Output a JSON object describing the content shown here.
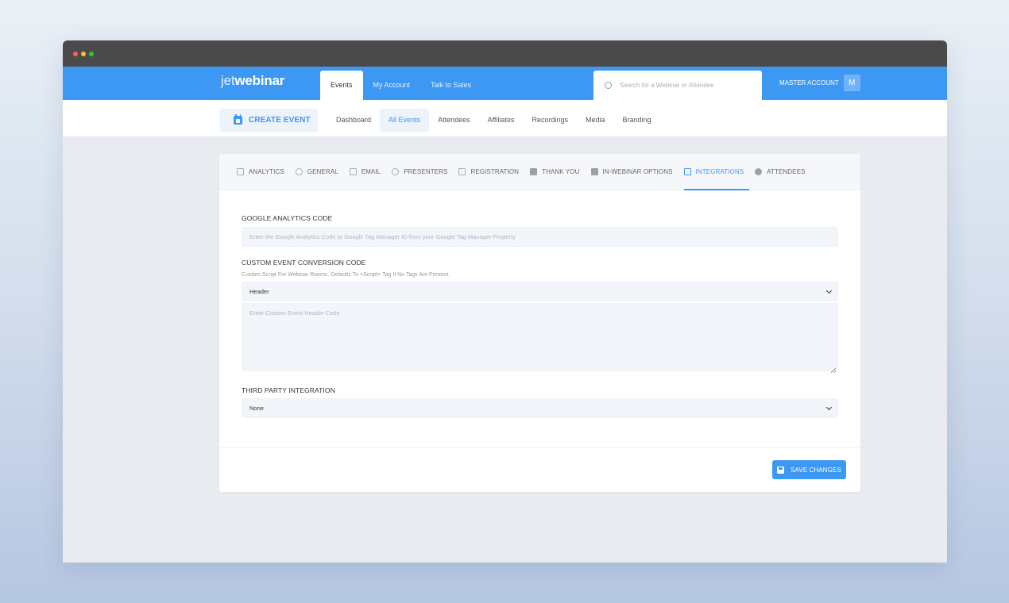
{
  "header": {
    "logo_light": "jet",
    "logo_bold": "webinar",
    "tabs": [
      {
        "label": "Events",
        "active": true
      },
      {
        "label": "My Account",
        "active": false
      },
      {
        "label": "Talk to Sales",
        "active": false
      }
    ],
    "search_placeholder": "Search for a Webinar or Attendee",
    "account_label": "MASTER ACCOUNT",
    "avatar_initial": "M"
  },
  "subnav": {
    "create_label": "CREATE EVENT",
    "items": [
      {
        "label": "Dashboard",
        "active": false
      },
      {
        "label": "All Events",
        "active": true
      },
      {
        "label": "Attendees",
        "active": false
      },
      {
        "label": "Affiliates",
        "active": false
      },
      {
        "label": "Recordings",
        "active": false
      },
      {
        "label": "Media",
        "active": false
      },
      {
        "label": "Branding",
        "active": false
      }
    ]
  },
  "event_tabs": [
    {
      "label": "ANALYTICS",
      "icon": "chart-icon"
    },
    {
      "label": "GENERAL",
      "icon": "gear-icon"
    },
    {
      "label": "EMAIL",
      "icon": "envelope-icon"
    },
    {
      "label": "PRESENTERS",
      "icon": "user-circle-icon"
    },
    {
      "label": "REGISTRATION",
      "icon": "form-icon"
    },
    {
      "label": "THANK YOU",
      "icon": "layers-icon"
    },
    {
      "label": "IN-WEBINAR OPTIONS",
      "icon": "grid-icon"
    },
    {
      "label": "INTEGRATIONS",
      "icon": "plug-icon",
      "active": true
    },
    {
      "label": "ATTENDEES",
      "icon": "user-icon"
    }
  ],
  "form": {
    "ga_label": "GOOGLE ANALYTICS CODE",
    "ga_placeholder": "Enter the Google Analytics Code or Google Tag Manager ID from your Google Tag Manager Property",
    "custom_label": "CUSTOM EVENT CONVERSION CODE",
    "custom_hint": "Custom Script For Webinar Rooms. Defaults To <Script> Tag If No Tags Are Present.",
    "position_value": "Header",
    "code_placeholder": "Enter Custom Event Header Code",
    "third_party_label": "THIRD PARTY INTEGRATION",
    "third_party_value": "None"
  },
  "footer": {
    "save_label": "SAVE CHANGES"
  },
  "colors": {
    "brand": "#3d98f4",
    "titlebar": "#4a4a4a"
  }
}
